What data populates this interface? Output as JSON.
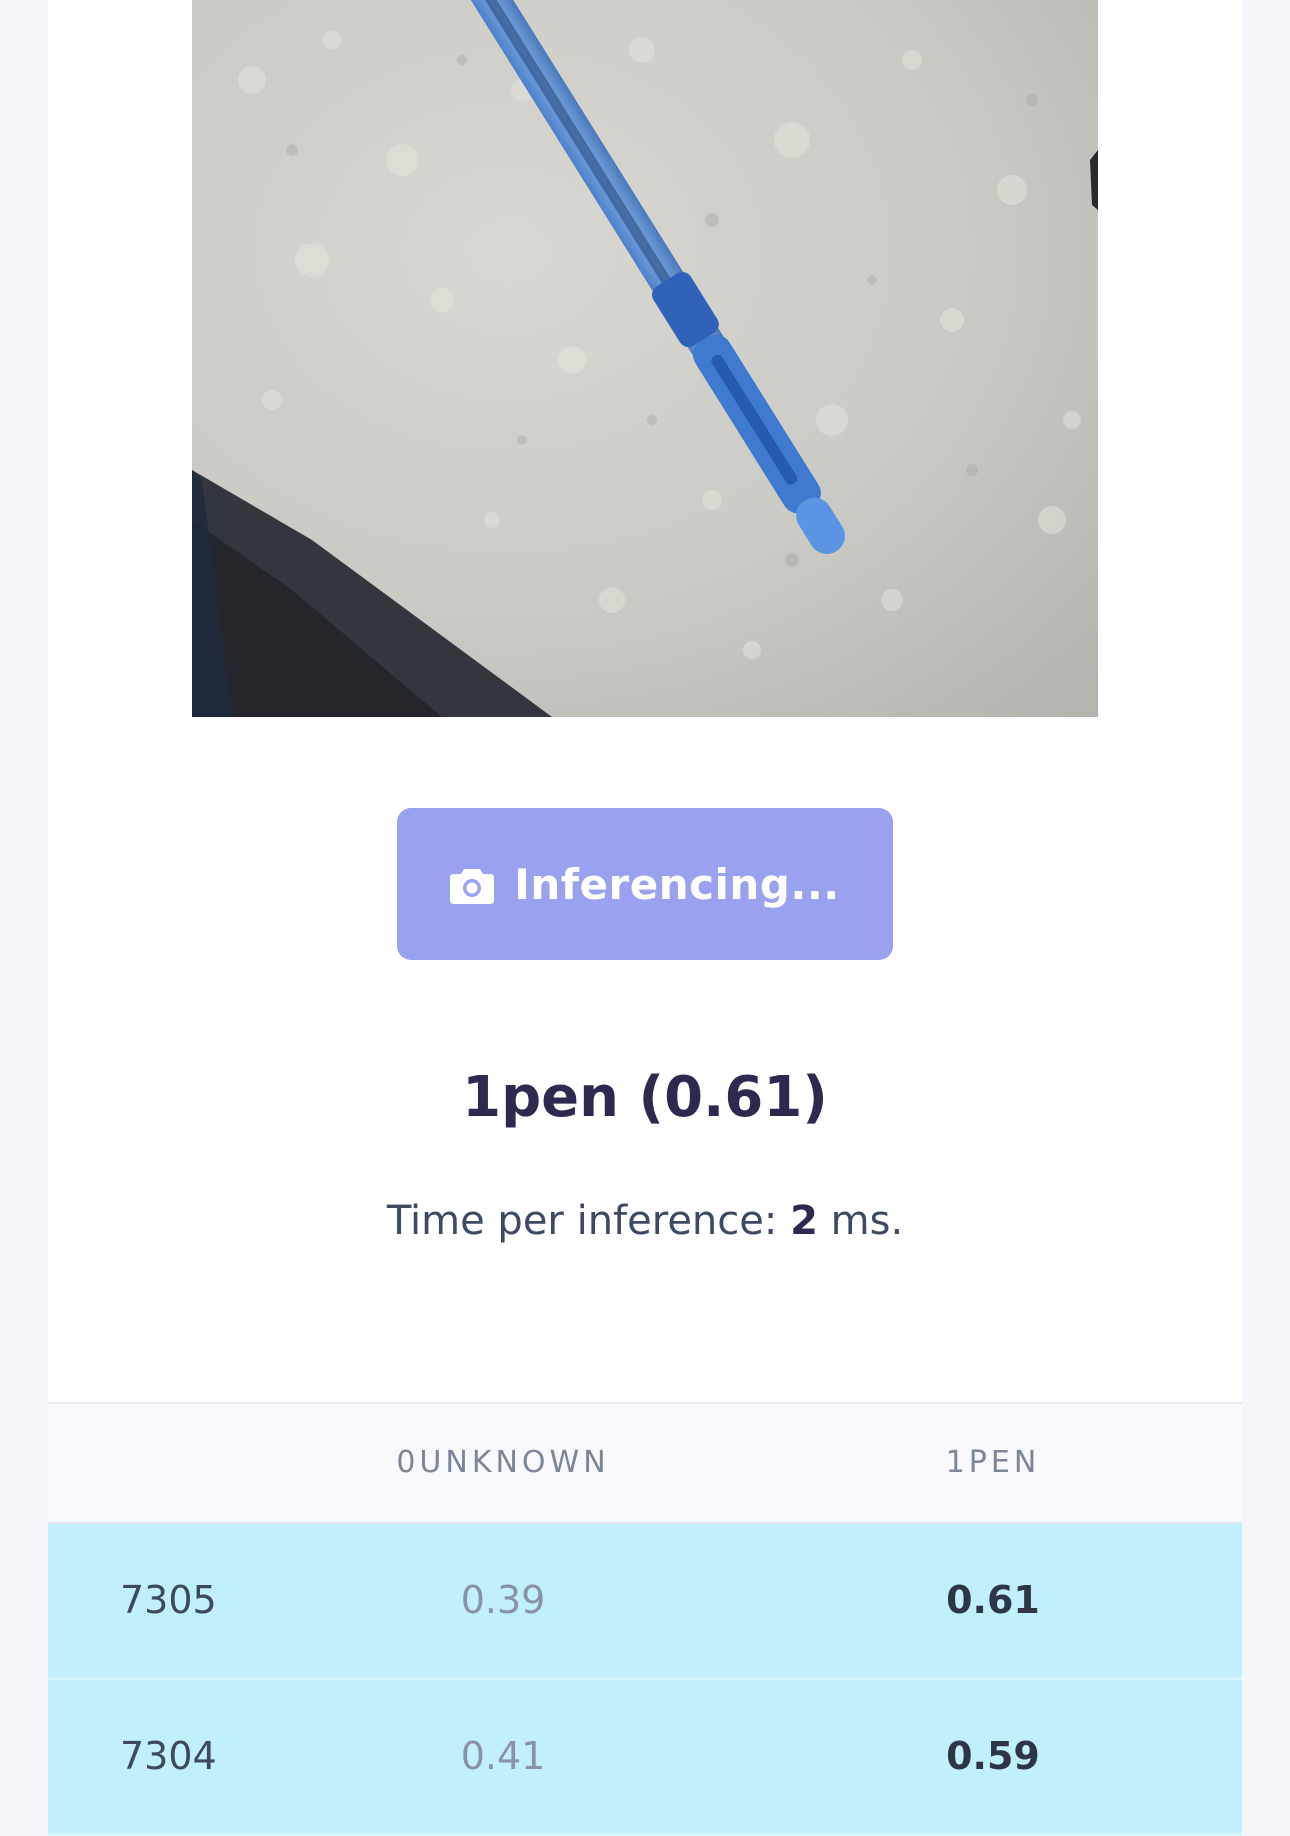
{
  "capture": {
    "button_label": "Inferencing...",
    "icon": "camera-icon"
  },
  "result": {
    "label": "1pen (0.61)"
  },
  "timing": {
    "prefix": "Time per inference:",
    "value": "2",
    "suffix": "ms."
  },
  "table": {
    "headers": [
      "0unknown",
      "1pen"
    ],
    "rows": [
      {
        "id": "7305",
        "unknown": "0.39",
        "pen": "0.61"
      },
      {
        "id": "7304",
        "unknown": "0.41",
        "pen": "0.59"
      }
    ]
  },
  "colors": {
    "button": "#9aa1ee",
    "row_highlight": "#c1effc",
    "title_text": "#2c2a4e"
  }
}
